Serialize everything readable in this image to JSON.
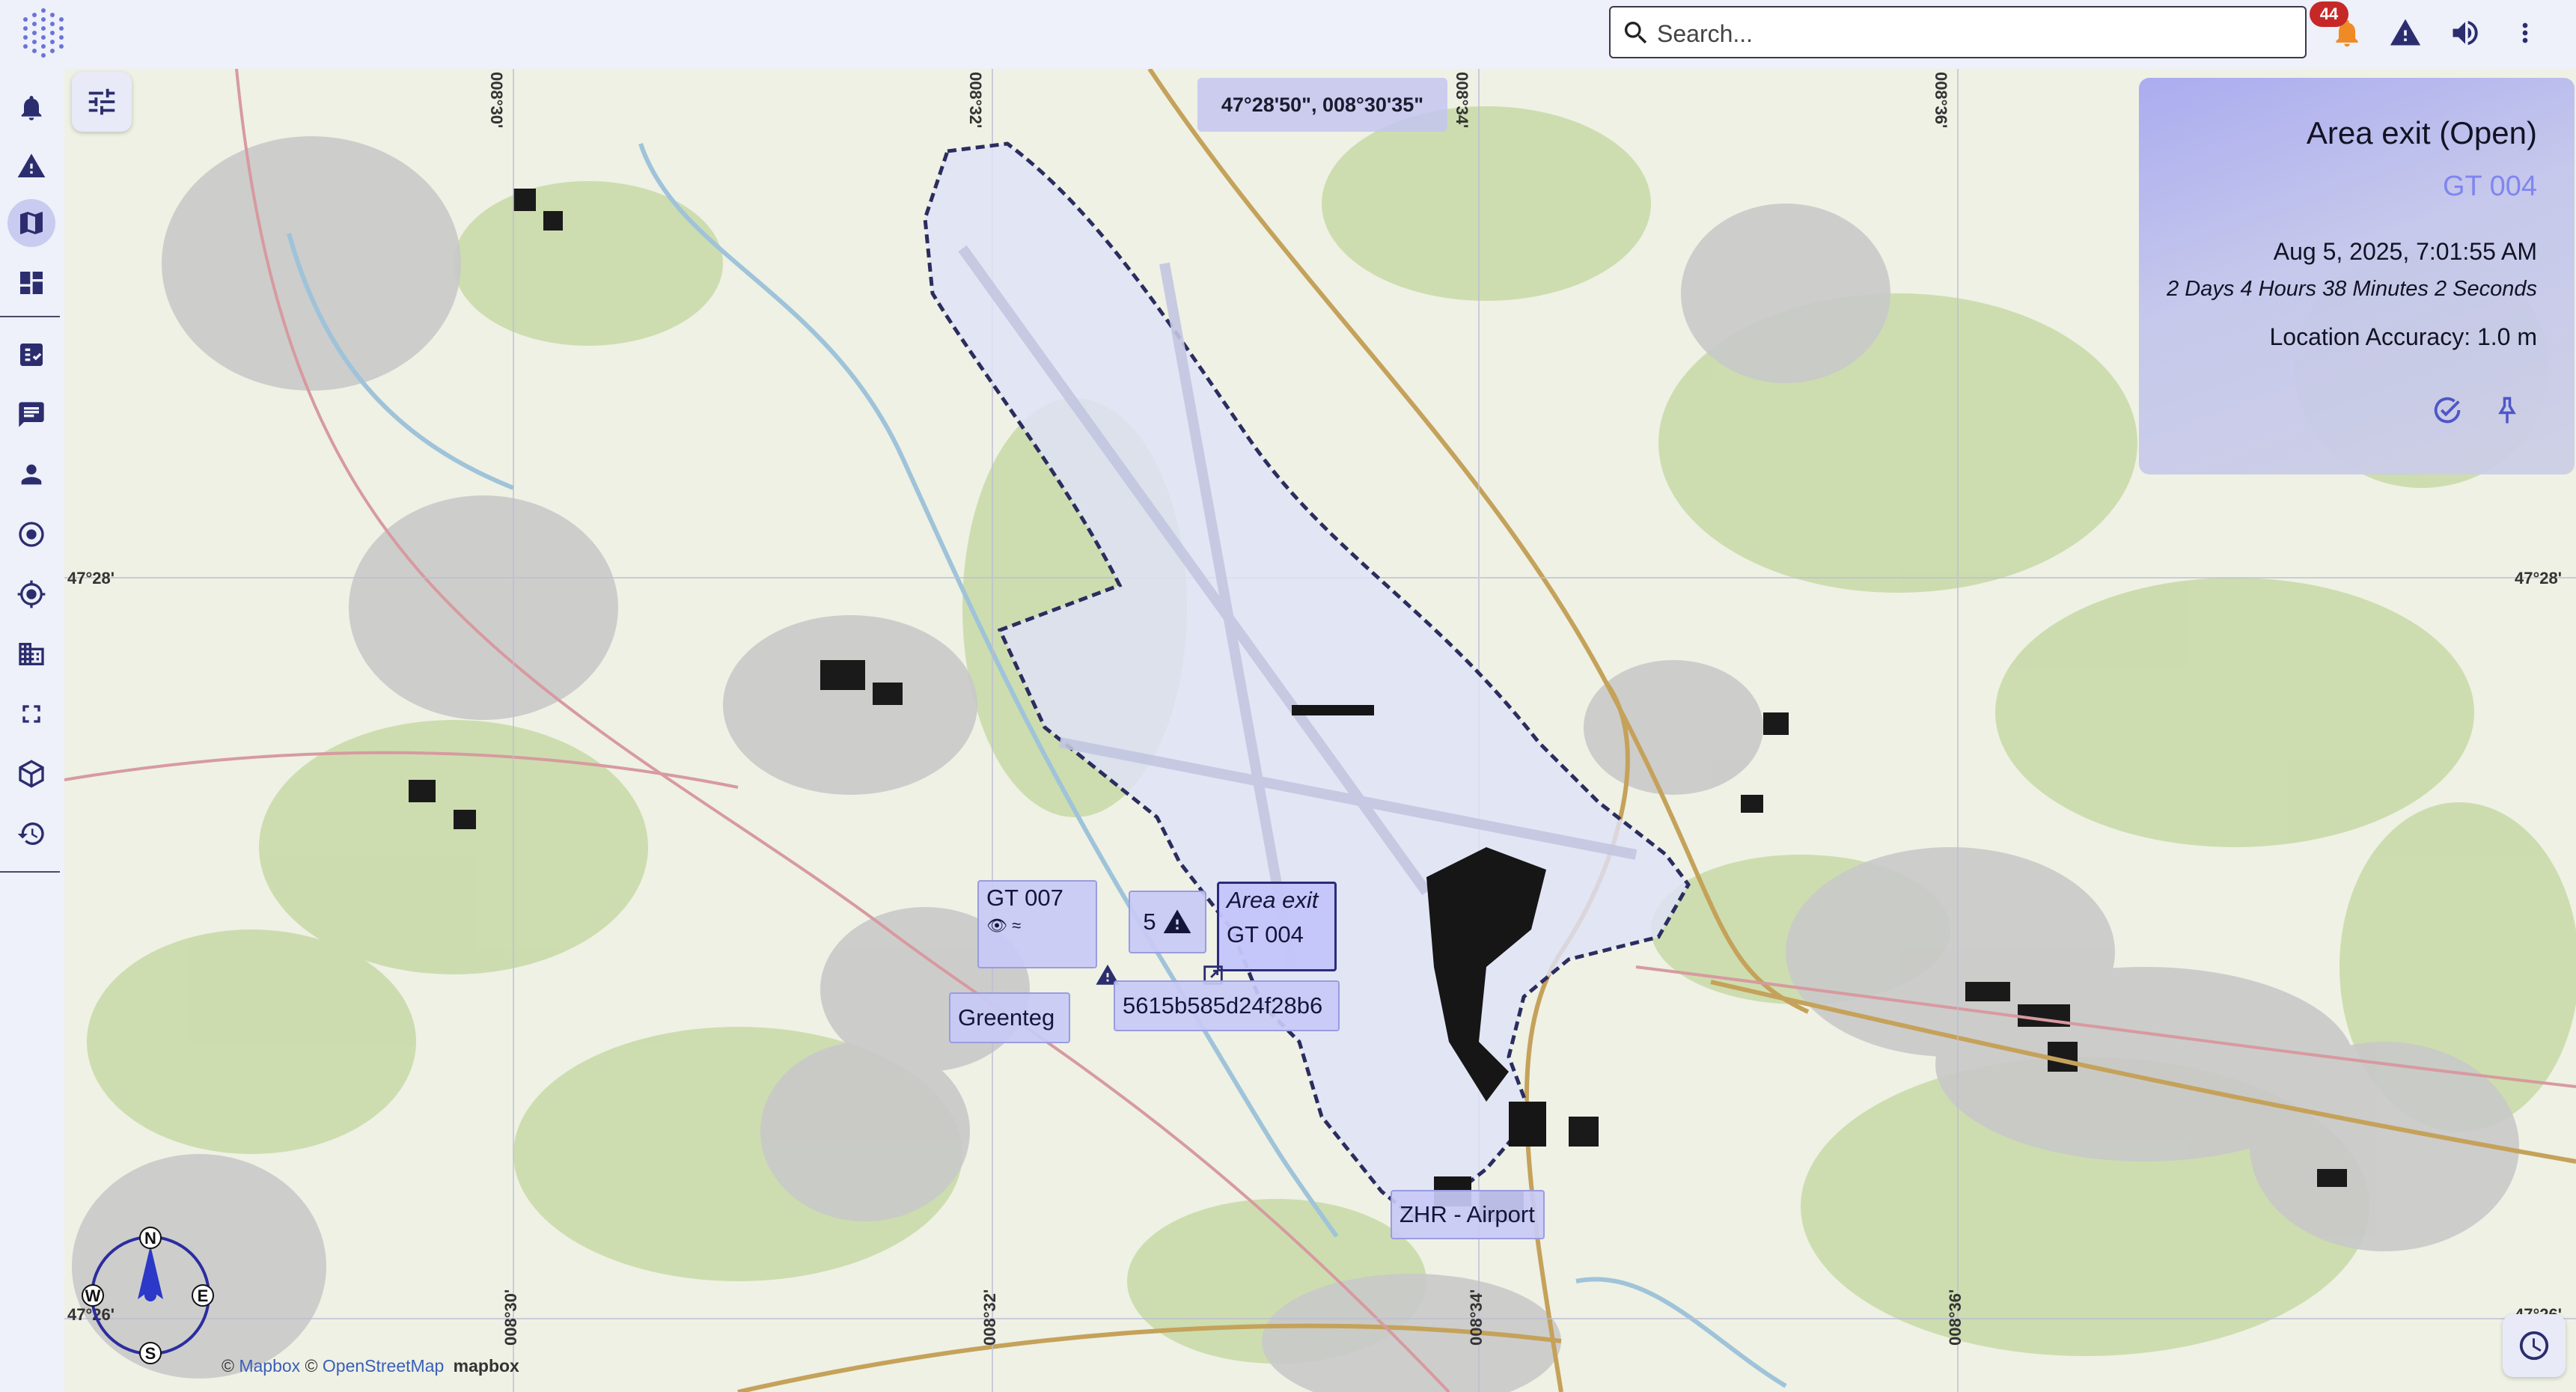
{
  "app": {
    "logo": "hexagon-dots-logo"
  },
  "search": {
    "placeholder": "Search..."
  },
  "toolbar": {
    "notification_count": "44",
    "icons": [
      "bell-icon",
      "warning-icon",
      "volume-icon",
      "more-vert-icon"
    ]
  },
  "sidebar": {
    "items": [
      {
        "icon": "bell-icon"
      },
      {
        "icon": "warning-icon"
      },
      {
        "icon": "map-icon",
        "active": true
      },
      {
        "icon": "dashboard-icon"
      },
      {
        "icon": "task-list-icon"
      },
      {
        "icon": "chat-icon"
      },
      {
        "icon": "person-icon"
      },
      {
        "icon": "target-icon"
      },
      {
        "icon": "gps-fixed-icon"
      },
      {
        "icon": "building-icon"
      },
      {
        "icon": "fullscreen-icon"
      },
      {
        "icon": "cube-icon"
      },
      {
        "icon": "history-icon"
      }
    ]
  },
  "map": {
    "coordinate_readout": "47°28'50\", 008°30'35\"",
    "edge_labels": {
      "left_lat": "47°28'",
      "right_lat": "47°28'",
      "left_lat_bottom": "47°26'",
      "right_lat_bottom": "47°26'",
      "top_lon_1": "008°30'",
      "top_lon_2": "008°32'",
      "top_lon_3": "008°34'",
      "top_lon_4": "008°36'",
      "bottom_lon_1": "008°30'",
      "bottom_lon_2": "008°32'",
      "bottom_lon_3": "008°34'",
      "bottom_lon_4": "008°36'"
    },
    "markers": {
      "gt007": "GT 007",
      "cluster_count": "5",
      "area_exit_title": "Area exit",
      "area_exit_device": "GT 004",
      "greenteg": "Greenteg",
      "device_id": "5615b585d24f28b6",
      "zhr_airport": "ZHR - Airport"
    },
    "attribution": {
      "mapbox": "Mapbox",
      "osm": "OpenStreetMap",
      "logo": "mapbox"
    },
    "compass": {
      "n": "N",
      "e": "E",
      "s": "S",
      "w": "W"
    },
    "colors": {
      "zone_fill": "#dfe2f8",
      "zone_border": "#2b2d5e",
      "accent": "#7f86ee"
    }
  },
  "panel": {
    "title": "Area exit (Open)",
    "device": "GT 004",
    "datetime": "Aug 5, 2025, 7:01:55 AM",
    "elapsed": "2 Days 4 Hours 38 Minutes 2 Seconds",
    "accuracy": "Location Accuracy: 1.0 m"
  }
}
